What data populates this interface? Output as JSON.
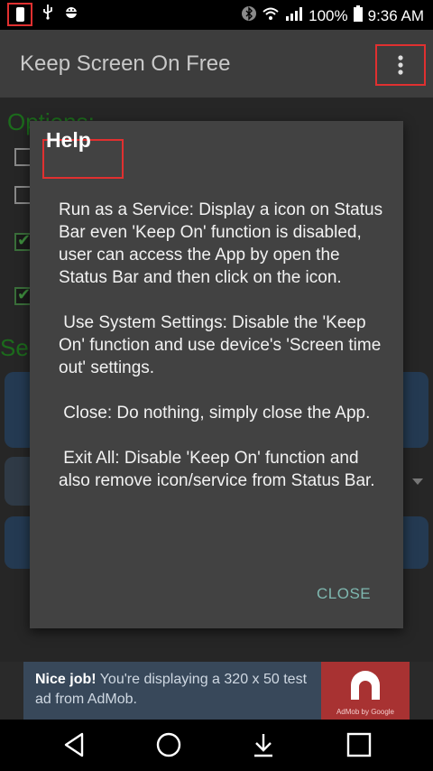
{
  "status_bar": {
    "battery": "100%",
    "time": "9:36 AM",
    "icons": [
      "phone-icon",
      "usb-icon",
      "android-debug-icon",
      "bluetooth-icon",
      "wifi-icon",
      "signal-icon",
      "battery-icon"
    ]
  },
  "app_bar": {
    "title": "Keep Screen On Free",
    "overflow_icon": "more-vert-icon"
  },
  "background": {
    "options_heading": "Options:",
    "settings_heading_partial": "Se"
  },
  "dialog": {
    "title": "Help",
    "body": "Run as a Service: Display a icon on Status Bar even 'Keep On' function is disabled, user can access the App by open the Status Bar and then click on the icon.\n\n Use System Settings: Disable the 'Keep On' function and use device's 'Screen time out' settings.\n\n Close: Do nothing, simply close the App.\n\n Exit All: Disable 'Keep On' function and also remove icon/service from Status Bar.",
    "close_label": "CLOSE"
  },
  "ad": {
    "headline": "Nice job!",
    "text": " You're displaying a 320 x 50 test ad from AdMob.",
    "logo_caption": "AdMob by Google"
  },
  "nav_bar": {
    "icons": [
      "back-icon",
      "home-icon",
      "notifications-down-icon",
      "recents-icon"
    ]
  },
  "colors": {
    "accent_close": "#7fb8b0",
    "highlight_box": "#e03030",
    "dialog_bg": "#424242"
  }
}
